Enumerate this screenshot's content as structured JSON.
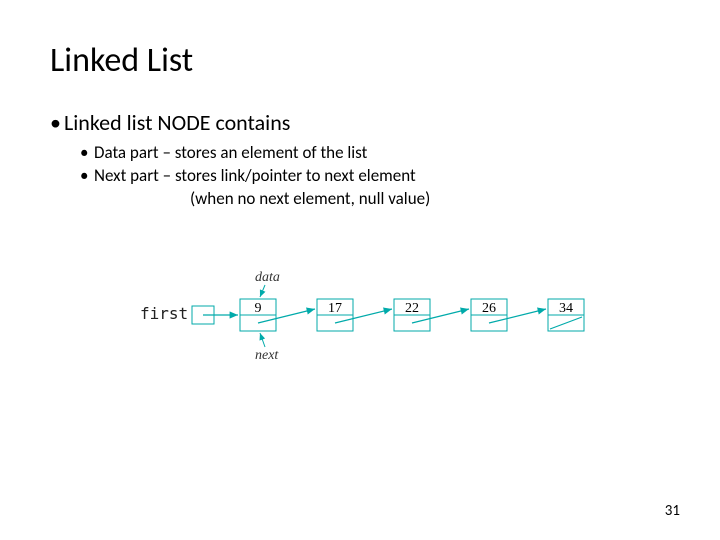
{
  "title": "Linked List",
  "bullet1": "Linked list NODE contains",
  "bullet2a": "Data part – stores an element of the list",
  "bullet2b": "Next part – stores link/pointer to next element",
  "bullet2c": "(when no next element, null value)",
  "diagram": {
    "first_label": "first",
    "data_label": "data",
    "next_label": "next",
    "values": [
      "9",
      "17",
      "22",
      "26",
      "34"
    ]
  },
  "pagenum": "31"
}
